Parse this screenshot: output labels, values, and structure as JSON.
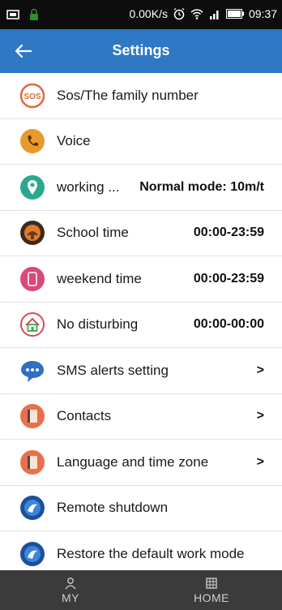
{
  "status_bar": {
    "network_speed": "0.00K/s",
    "time": "09:37",
    "icons": [
      "image-icon",
      "lock-icon",
      "alarm-icon",
      "wifi-icon",
      "signal-icon",
      "battery-icon"
    ]
  },
  "header": {
    "title": "Settings",
    "back_icon": "back-arrow-icon"
  },
  "items": [
    {
      "label": "Sos/The family number",
      "value": "",
      "icon": "sos-icon"
    },
    {
      "label": "Voice",
      "value": "",
      "icon": "phone-icon"
    },
    {
      "label": "working ...",
      "value": "Normal mode: 10m/t",
      "icon": "location-pin-icon"
    },
    {
      "label": "School time",
      "value": "00:00-23:59",
      "icon": "school-icon"
    },
    {
      "label": "weekend time",
      "value": "00:00-23:59",
      "icon": "weekend-icon"
    },
    {
      "label": "No disturbing",
      "value": "00:00-00:00",
      "icon": "no-disturb-icon"
    },
    {
      "label": "SMS alerts setting",
      "value": ">",
      "icon": "sms-icon"
    },
    {
      "label": "Contacts",
      "value": ">",
      "icon": "contacts-icon"
    },
    {
      "label": "Language and time zone",
      "value": ">",
      "icon": "language-icon"
    },
    {
      "label": "Remote shutdown",
      "value": "",
      "icon": "power-icon"
    },
    {
      "label": "Restore the default work mode",
      "value": "",
      "icon": "restore-icon"
    }
  ],
  "bottom_nav": {
    "my_label": "MY",
    "home_label": "HOME"
  },
  "colors": {
    "header_bg": "#2f78c4",
    "bottom_nav_bg": "#3b3b3b",
    "status_bar_bg": "#0d0d0d"
  }
}
